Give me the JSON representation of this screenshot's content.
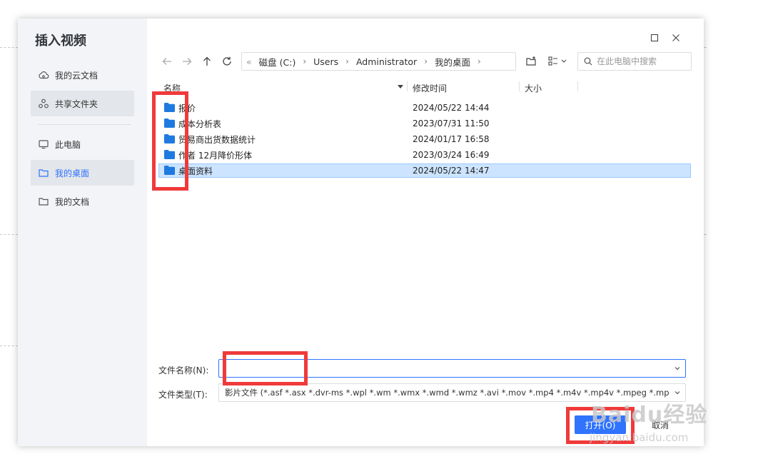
{
  "dialog": {
    "title": "插入视频"
  },
  "sidebar": {
    "items": [
      {
        "label": "我的云文档",
        "icon": "cloud-icon"
      },
      {
        "label": "共享文件夹",
        "icon": "share-icon"
      },
      {
        "label": "此电脑",
        "icon": "monitor-icon"
      },
      {
        "label": "我的桌面",
        "icon": "folder-icon"
      },
      {
        "label": "我的文档",
        "icon": "folder-icon"
      }
    ]
  },
  "pathbar": {
    "segments": [
      "磁盘 (C:)",
      "Users",
      "Administrator",
      "我的桌面"
    ]
  },
  "search": {
    "placeholder": "在此电脑中搜索"
  },
  "columns": {
    "name": "名称",
    "modified": "修改时间",
    "size": "大小"
  },
  "files": [
    {
      "name": "报价",
      "modified": "2024/05/22 14:44"
    },
    {
      "name": "成本分析表",
      "modified": "2023/07/31 11:50"
    },
    {
      "name": "贸易商出货数据统计",
      "modified": "2024/01/17 16:58"
    },
    {
      "name": "作者 12月降价形体",
      "modified": "2023/03/24 16:49"
    },
    {
      "name": "桌面资料",
      "modified": "2024/05/22 14:47"
    }
  ],
  "form": {
    "filename_label": "文件名称(N):",
    "filename_value": "",
    "filetype_label": "文件类型(T):",
    "filetype_value": "影片文件 (*.asf *.asx *.dvr-ms *.wpl *.wm *.wmx *.wmd *.wmz *.avi *.mov *.mp4 *.m4v *.mp4v *.mpeg *.mpg"
  },
  "buttons": {
    "open": "打开(O)",
    "cancel": "取消"
  },
  "watermark": {
    "logo": "Baidu经验",
    "url": "jingyan.baidu.com"
  },
  "colors": {
    "accent": "#2f73ff",
    "folder": "#1f7ae0",
    "highlight_box": "#f03a3a",
    "selected_row": "#cce4ff"
  }
}
